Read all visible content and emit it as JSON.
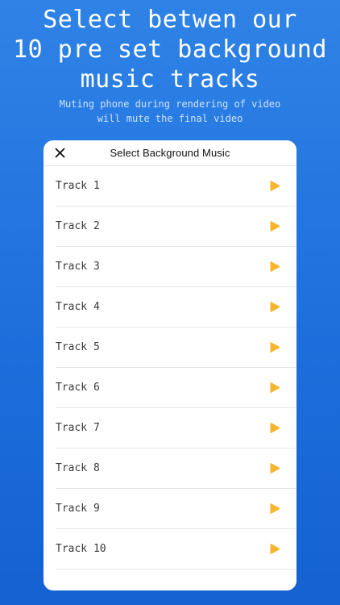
{
  "promo": {
    "headline_lines": [
      "Select betwen our",
      "10 pre set background",
      "music tracks"
    ],
    "subline_lines": [
      "Muting phone during rendering of video",
      "will mute the final video"
    ]
  },
  "sheet": {
    "title": "Select Background Music",
    "close_icon": "close-icon",
    "play_icon": "play-icon",
    "accent_color": "#f7b52c",
    "tracks": [
      {
        "label": "Track 1"
      },
      {
        "label": "Track 2"
      },
      {
        "label": "Track 3"
      },
      {
        "label": "Track 4"
      },
      {
        "label": "Track 5"
      },
      {
        "label": "Track 6"
      },
      {
        "label": "Track 7"
      },
      {
        "label": "Track 8"
      },
      {
        "label": "Track 9"
      },
      {
        "label": "Track 10"
      }
    ]
  }
}
